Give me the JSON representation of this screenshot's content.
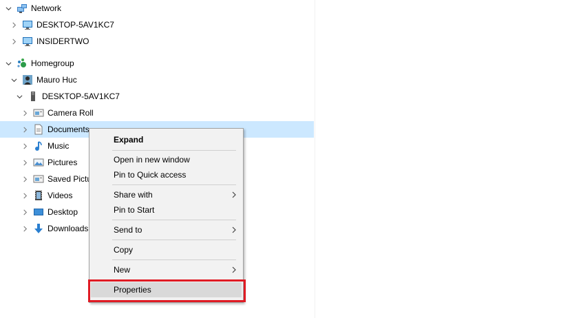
{
  "tree": {
    "network": {
      "label": "Network",
      "icon": "network-icon"
    },
    "pc1": {
      "label": "DESKTOP-5AV1KC7",
      "icon": "computer-icon"
    },
    "pc2": {
      "label": "INSIDERTWO",
      "icon": "computer-icon"
    },
    "homegroup": {
      "label": "Homegroup",
      "icon": "homegroup-icon"
    },
    "user": {
      "label": "Mauro Huc",
      "icon": "user-icon"
    },
    "device": {
      "label": "DESKTOP-5AV1KC7",
      "icon": "tower-pc-icon"
    },
    "folders": [
      {
        "label": "Camera Roll",
        "icon": "camera-roll-icon"
      },
      {
        "label": "Documents",
        "icon": "documents-icon"
      },
      {
        "label": "Music",
        "icon": "music-icon"
      },
      {
        "label": "Pictures",
        "icon": "pictures-icon"
      },
      {
        "label": "Saved Pictu",
        "icon": "saved-pictures-icon"
      },
      {
        "label": "Videos",
        "icon": "videos-icon"
      },
      {
        "label": "Desktop",
        "icon": "desktop-icon"
      },
      {
        "label": "Downloads",
        "icon": "downloads-icon"
      }
    ]
  },
  "context_menu": {
    "expand": "Expand",
    "open_new_window": "Open in new window",
    "pin_quick_access": "Pin to Quick access",
    "share_with": "Share with",
    "pin_to_start": "Pin to Start",
    "send_to": "Send to",
    "copy": "Copy",
    "new": "New",
    "properties": "Properties"
  },
  "colors": {
    "selection": "#cce8ff",
    "menu_bg": "#f2f2f2",
    "highlight": "#e01b24"
  }
}
